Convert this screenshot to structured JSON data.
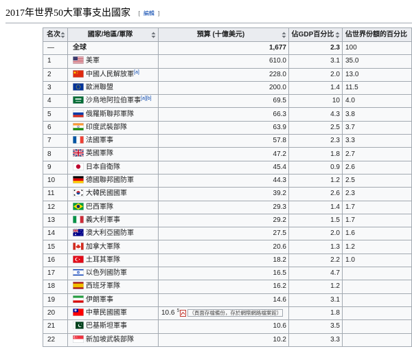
{
  "page": {
    "title": "2017年世界50大軍事支出國家",
    "edit_bracket_open": "[",
    "edit_label": "編輯",
    "edit_bracket_close": "]"
  },
  "table": {
    "columns": {
      "rank": "名次",
      "country": "國家/地區/軍隊",
      "budget": "預算 (十億美元)",
      "gdp": "佔GDP百分比",
      "share": "佔世界份額的百分比"
    },
    "total": {
      "rank": "—",
      "name": "全球",
      "budget": "1,677",
      "gdp": "2.3",
      "share": "100"
    },
    "rows": [
      {
        "rank": "1",
        "name": "美軍",
        "flag": "us-flag",
        "budget": "610.0",
        "gdp": "3.1",
        "share": "35.0"
      },
      {
        "rank": "2",
        "name": "中國人民解放軍",
        "notes": [
          "[a]"
        ],
        "flag": "china-flag",
        "budget": "228.0",
        "gdp": "2.0",
        "share": "13.0"
      },
      {
        "rank": "3",
        "name": "歐洲聯盟",
        "flag": "eu-flag",
        "budget": "200.0",
        "gdp": "1.4",
        "share": "11.5"
      },
      {
        "rank": "4",
        "name": "沙烏地阿拉伯軍事",
        "notes": [
          "[a]",
          "[b]"
        ],
        "flag": "saudi-arabia-flag",
        "budget": "69.5",
        "gdp": "10",
        "share": "4.0"
      },
      {
        "rank": "5",
        "name": "俄羅斯聯邦軍隊",
        "flag": "russia-flag",
        "budget": "66.3",
        "gdp": "4.3",
        "share": "3.8"
      },
      {
        "rank": "6",
        "name": "印度武裝部隊",
        "flag": "india-flag",
        "budget": "63.9",
        "gdp": "2.5",
        "share": "3.7"
      },
      {
        "rank": "7",
        "name": "法國軍事",
        "flag": "france-flag",
        "budget": "57.8",
        "gdp": "2.3",
        "share": "3.3"
      },
      {
        "rank": "8",
        "name": "英國軍隊",
        "flag": "uk-flag",
        "budget": "47.2",
        "gdp": "1.8",
        "share": "2.7"
      },
      {
        "rank": "9",
        "name": "日本自衛隊",
        "flag": "japan-flag",
        "budget": "45.4",
        "gdp": "0.9",
        "share": "2.6"
      },
      {
        "rank": "10",
        "name": "德國聯邦國防軍",
        "flag": "germany-flag",
        "budget": "44.3",
        "gdp": "1.2",
        "share": "2.5"
      },
      {
        "rank": "11",
        "name": "大韓民國國軍",
        "flag": "south-korea-flag",
        "budget": "39.2",
        "gdp": "2.6",
        "share": "2.3"
      },
      {
        "rank": "12",
        "name": "巴西軍隊",
        "flag": "brazil-flag",
        "budget": "29.3",
        "gdp": "1.4",
        "share": "1.7"
      },
      {
        "rank": "13",
        "name": "義大利軍事",
        "flag": "italy-flag",
        "budget": "29.2",
        "gdp": "1.5",
        "share": "1.7"
      },
      {
        "rank": "14",
        "name": "澳大利亞國防軍",
        "flag": "australia-flag",
        "budget": "27.5",
        "gdp": "2.0",
        "share": "1.6"
      },
      {
        "rank": "15",
        "name": "加拿大軍隊",
        "flag": "canada-flag",
        "budget": "20.6",
        "gdp": "1.3",
        "share": "1.2"
      },
      {
        "rank": "16",
        "name": "土耳其軍隊",
        "flag": "turkey-flag",
        "budget": "18.2",
        "gdp": "2.2",
        "share": "1.0"
      },
      {
        "rank": "17",
        "name": "以色列國防軍",
        "flag": "israel-flag",
        "budget": "16.5",
        "gdp": "4.7"
      },
      {
        "rank": "18",
        "name": "西班牙軍隊",
        "flag": "spain-flag",
        "budget": "16.2",
        "gdp": "1.2"
      },
      {
        "rank": "19",
        "name": "伊朗軍事",
        "flag": "iran-flag",
        "budget": "14.6",
        "gdp": "3.1"
      },
      {
        "rank": "20",
        "name": "中華民國國軍",
        "flag": "taiwan-flag",
        "budget": "10.6",
        "budget_link": "5",
        "budget_link_icon": "pdf-icon",
        "archive_note": "（頁面存檔備份，存於網際網路檔案館）",
        "gdp": "1.8"
      },
      {
        "rank": "21",
        "name": "巴基斯坦軍事",
        "flag": "pakistan-flag",
        "budget": "10.6",
        "gdp": "3.5"
      },
      {
        "rank": "22",
        "name": "新加坡武裝部隊",
        "flag": "singapore-flag",
        "budget": "10.2",
        "gdp": "3.3"
      }
    ]
  }
}
